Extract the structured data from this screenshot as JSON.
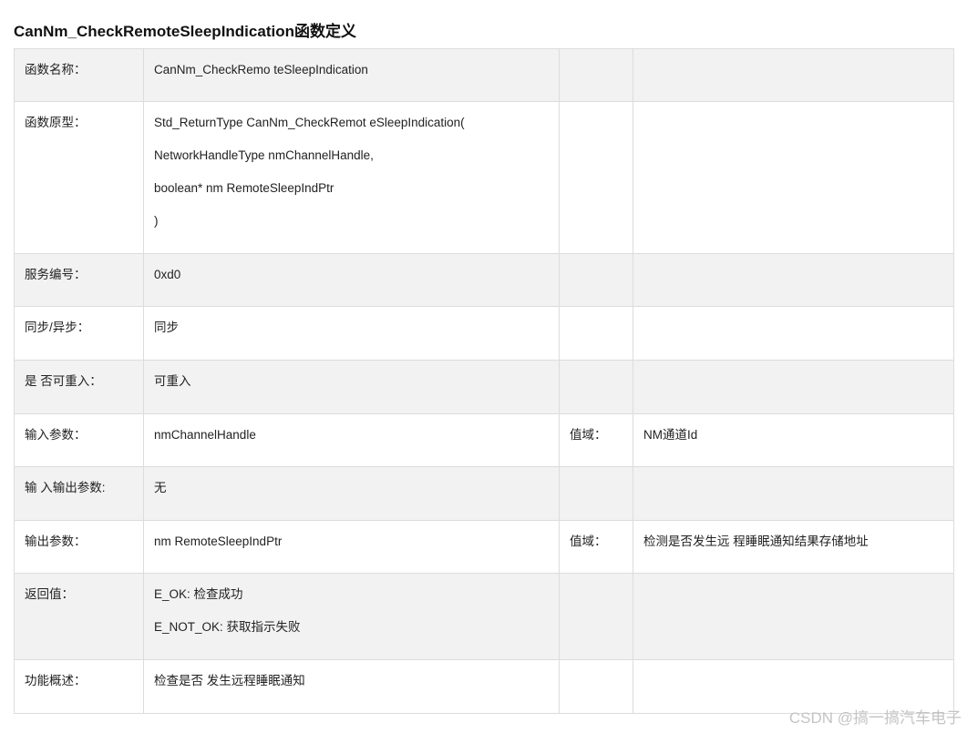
{
  "title": "CanNm_CheckRemoteSleepIndication函数定义",
  "rows": [
    {
      "label": "函数名称：",
      "value": [
        "CanNm_CheckRemo teSleepIndication"
      ],
      "range_label": "",
      "range_value": ""
    },
    {
      "label": "函数原型：",
      "value": [
        "Std_ReturnType CanNm_CheckRemot eSleepIndication(",
        "NetworkHandleType nmChannelHandle,",
        "boolean* nm RemoteSleepIndPtr",
        ")"
      ],
      "range_label": "",
      "range_value": ""
    },
    {
      "label": "服务编号：",
      "value": [
        "0xd0"
      ],
      "range_label": "",
      "range_value": ""
    },
    {
      "label": "同步/异步：",
      "value": [
        "同步"
      ],
      "range_label": "",
      "range_value": ""
    },
    {
      "label": "是 否可重入：",
      "value": [
        "可重入"
      ],
      "range_label": "",
      "range_value": ""
    },
    {
      "label": "输入参数：",
      "value": [
        "nmChannelHandle"
      ],
      "range_label": "值域：",
      "range_value": "NM通道Id"
    },
    {
      "label": "输 入输出参数:",
      "value": [
        "无"
      ],
      "range_label": "",
      "range_value": ""
    },
    {
      "label": "输出参数：",
      "value": [
        "nm RemoteSleepIndPtr"
      ],
      "range_label": "值域：",
      "range_value": "检测是否发生远 程睡眠通知结果存储地址"
    },
    {
      "label": "返回值：",
      "value": [
        "E_OK: 检查成功",
        "E_NOT_OK: 获取指示失败"
      ],
      "range_label": "",
      "range_value": ""
    },
    {
      "label": "功能概述：",
      "value": [
        "检查是否 发生远程睡眠通知"
      ],
      "range_label": "",
      "range_value": ""
    }
  ],
  "watermark": "CSDN @搞一搞汽车电子"
}
